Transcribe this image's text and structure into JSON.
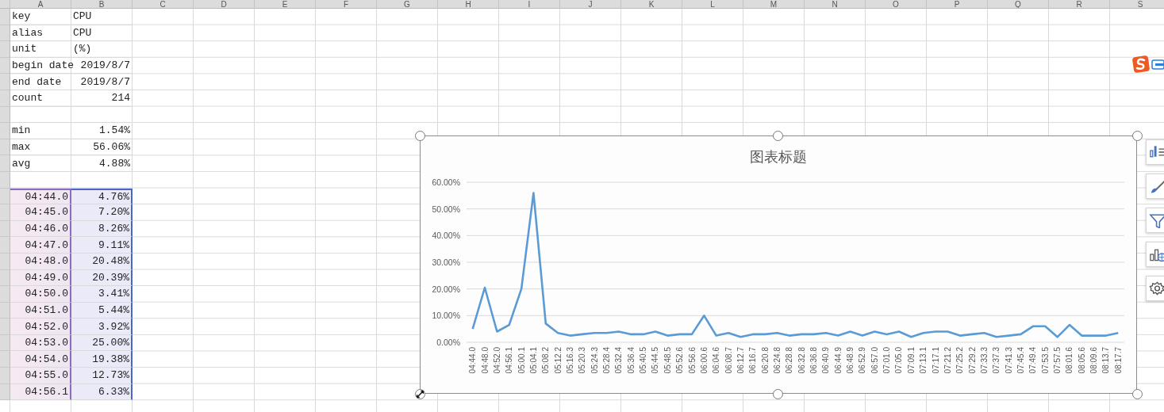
{
  "sheet": {
    "columns": [
      "A",
      "B",
      "C",
      "D",
      "E",
      "F",
      "G",
      "H",
      "I",
      "J",
      "K",
      "L",
      "M",
      "N",
      "O",
      "P",
      "Q",
      "R",
      "S"
    ],
    "rows": [
      {
        "kind": "text",
        "selected": false,
        "a": "key",
        "b": "CPU"
      },
      {
        "kind": "text",
        "selected": false,
        "a": "alias",
        "b": "CPU"
      },
      {
        "kind": "text",
        "selected": false,
        "a": "unit",
        "b": "(%)"
      },
      {
        "kind": "number",
        "selected": false,
        "a": "begin date",
        "b": "2019/8/7"
      },
      {
        "kind": "number",
        "selected": false,
        "a": "end date",
        "b": "2019/8/7"
      },
      {
        "kind": "number",
        "selected": false,
        "a": "count",
        "b": "214"
      },
      {
        "kind": "blank",
        "selected": false
      },
      {
        "kind": "number",
        "selected": false,
        "a": "min",
        "b": "1.54%"
      },
      {
        "kind": "number",
        "selected": false,
        "a": "max",
        "b": "56.06%"
      },
      {
        "kind": "number",
        "selected": false,
        "a": "avg",
        "b": "4.88%"
      },
      {
        "kind": "blank",
        "selected": false
      },
      {
        "kind": "data",
        "selected": true,
        "a": "04:44.0",
        "b": "4.76%"
      },
      {
        "kind": "data",
        "selected": true,
        "a": "04:45.0",
        "b": "7.20%"
      },
      {
        "kind": "data",
        "selected": true,
        "a": "04:46.0",
        "b": "8.26%"
      },
      {
        "kind": "data",
        "selected": true,
        "a": "04:47.0",
        "b": "9.11%"
      },
      {
        "kind": "data",
        "selected": true,
        "a": "04:48.0",
        "b": "20.48%"
      },
      {
        "kind": "data",
        "selected": true,
        "a": "04:49.0",
        "b": "20.39%"
      },
      {
        "kind": "data",
        "selected": true,
        "a": "04:50.0",
        "b": "3.41%"
      },
      {
        "kind": "data",
        "selected": true,
        "a": "04:51.0",
        "b": "5.44%"
      },
      {
        "kind": "data",
        "selected": true,
        "a": "04:52.0",
        "b": "3.92%"
      },
      {
        "kind": "data",
        "selected": true,
        "a": "04:53.0",
        "b": "25.00%"
      },
      {
        "kind": "data",
        "selected": true,
        "a": "04:54.0",
        "b": "19.38%"
      },
      {
        "kind": "data",
        "selected": true,
        "a": "04:55.0",
        "b": "12.73%"
      },
      {
        "kind": "data",
        "selected": true,
        "a": "04:56.1",
        "b": "6.33%"
      }
    ]
  },
  "chart": {
    "chart_data": {
      "type": "line",
      "title": "图表标题",
      "ylim": [
        0,
        60
      ],
      "yticks": [
        {
          "value": 0,
          "label": "0.00%"
        },
        {
          "value": 10,
          "label": "10.00%"
        },
        {
          "value": 20,
          "label": "20.00%"
        },
        {
          "value": 30,
          "label": "30.00%"
        },
        {
          "value": 40,
          "label": "40.00%"
        },
        {
          "value": 50,
          "label": "50.00%"
        },
        {
          "value": 60,
          "label": "60.00%"
        }
      ],
      "grid": true,
      "categories": [
        "04:44.0",
        "04:48.0",
        "04:52.0",
        "04:56.1",
        "05:00.1",
        "05:04.1",
        "05:08.2",
        "05:12.2",
        "05:16.3",
        "05:20.3",
        "05:24.3",
        "05:28.4",
        "05:32.4",
        "05:36.4",
        "05:40.5",
        "05:44.5",
        "05:48.5",
        "05:52.6",
        "05:56.6",
        "06:00.6",
        "06:04.6",
        "06:08.7",
        "06:12.7",
        "06:16.7",
        "06:20.8",
        "06:24.8",
        "06:28.8",
        "06:32.8",
        "06:36.8",
        "06:40.9",
        "06:44.9",
        "06:48.9",
        "06:52.9",
        "06:57.0",
        "07:01.0",
        "07:05.0",
        "07:09.1",
        "07:13.1",
        "07:17.1",
        "07:21.2",
        "07:25.2",
        "07:29.2",
        "07:33.3",
        "07:37.3",
        "07:41.3",
        "07:45.4",
        "07:49.4",
        "07:53.5",
        "07:57.5",
        "08:01.6",
        "08:05.6",
        "08:09.6",
        "08:13.7",
        "08:17.7"
      ],
      "series": [
        {
          "color": "#5b9bd5",
          "values": [
            5,
            20.5,
            4,
            6.5,
            20,
            56,
            7,
            3.5,
            2.5,
            3,
            3.5,
            3.5,
            4,
            3,
            3,
            4,
            2.5,
            3,
            3,
            10,
            2.5,
            3.5,
            2,
            3,
            3,
            3.5,
            2.5,
            3,
            3,
            3.5,
            2.5,
            4,
            2.5,
            4,
            3,
            4,
            2,
            3.5,
            4,
            4,
            2.5,
            3,
            3.5,
            2,
            2.5,
            3,
            6,
            6,
            2,
            6.5,
            2.5,
            2.5,
            2.5,
            3.5
          ]
        }
      ]
    }
  },
  "chart_tools": [
    {
      "kind": "elements"
    },
    {
      "kind": "style"
    },
    {
      "kind": "filter"
    },
    {
      "kind": "online"
    },
    {
      "kind": "settings"
    }
  ]
}
